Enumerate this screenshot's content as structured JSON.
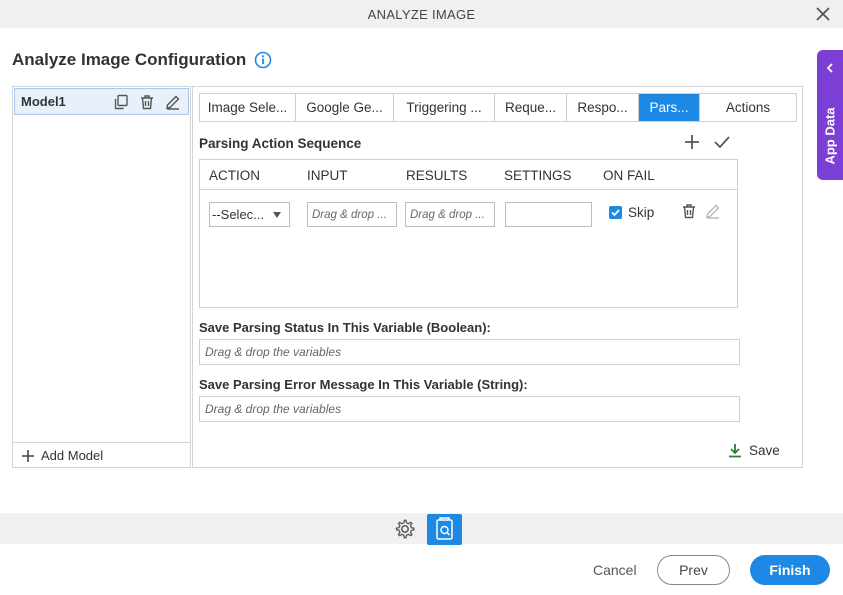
{
  "window": {
    "title": "ANALYZE IMAGE"
  },
  "page": {
    "title": "Analyze Image Configuration"
  },
  "app_data": {
    "label": "App Data"
  },
  "models": {
    "items": [
      {
        "label": "Model1"
      }
    ],
    "add_label": "Add Model"
  },
  "tabs": [
    {
      "label": "Image Sele..."
    },
    {
      "label": "Google Ge..."
    },
    {
      "label": "Triggering ..."
    },
    {
      "label": "Reque..."
    },
    {
      "label": "Respo..."
    },
    {
      "label": "Pars...",
      "active": true
    },
    {
      "label": "Actions"
    }
  ],
  "parsing": {
    "section_title": "Parsing Action Sequence",
    "columns": [
      "ACTION",
      "INPUT",
      "RESULTS",
      "SETTINGS",
      "ON FAIL"
    ],
    "row": {
      "action_value": "--Selec...",
      "input_placeholder": "Drag & drop ...",
      "results_placeholder": "Drag & drop ...",
      "settings_value": "",
      "on_fail_label": "Skip",
      "on_fail_checked": true
    }
  },
  "variables": {
    "status_label": "Save Parsing Status In This Variable (Boolean):",
    "status_placeholder": "Drag & drop the variables",
    "error_label": "Save Parsing Error Message In This Variable (String):",
    "error_placeholder": "Drag & drop the variables"
  },
  "save_label": "Save",
  "footer": {
    "cancel": "Cancel",
    "prev": "Prev",
    "finish": "Finish"
  },
  "colors": {
    "accent": "#1e88e5",
    "app_data": "#7b3fd6",
    "save_icon": "#2e7d32"
  }
}
